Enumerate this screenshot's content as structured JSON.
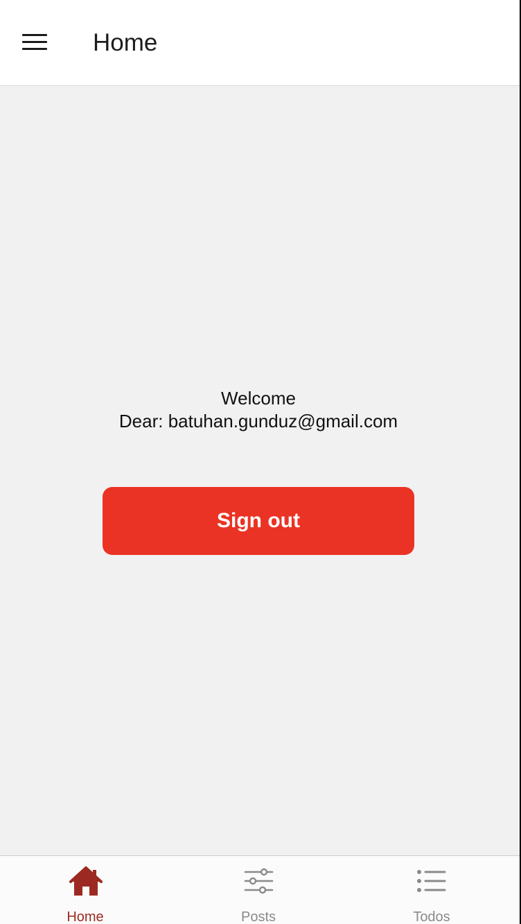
{
  "header": {
    "title": "Home",
    "menu_icon": "hamburger-menu-icon"
  },
  "main": {
    "welcome_line": "Welcome",
    "dear_line": "Dear: batuhan.gunduz@gmail.com",
    "signout_label": "Sign out"
  },
  "tabbar": {
    "tabs": [
      {
        "label": "Home",
        "icon": "house-icon",
        "active": true
      },
      {
        "label": "Posts",
        "icon": "sliders-icon",
        "active": false
      },
      {
        "label": "Todos",
        "icon": "list-icon",
        "active": false
      }
    ]
  },
  "colors": {
    "accent": "#ea3324",
    "active_tab": "#9c2a22",
    "inactive_tab": "#8a8a8a",
    "background": "#f1f1f1",
    "header_bg": "#ffffff"
  }
}
